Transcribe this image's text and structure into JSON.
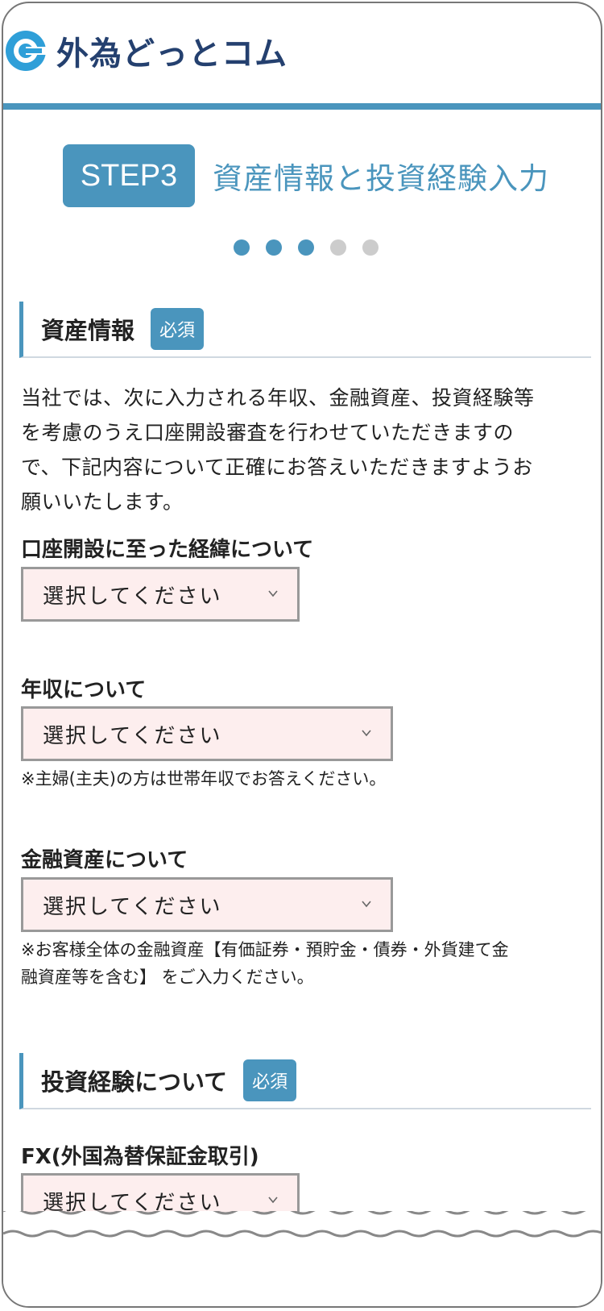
{
  "header": {
    "logo_text": "外為どっとコム"
  },
  "step": {
    "badge": "STEP3",
    "title": "資産情報と投資経験入力"
  },
  "progress": {
    "total": 5,
    "current": 3
  },
  "sections": {
    "asset": {
      "title": "資産情報",
      "required": "必須"
    },
    "invest": {
      "title": "投資経験について",
      "required": "必須"
    }
  },
  "intro_lines": [
    "当社では、次に入力される年収、金融資産、投資経験等",
    "を考慮のうえ口座開設審査を行わせていただきますの",
    "で、下記内容について正確にお答えいただきますようお",
    "願いいたします。"
  ],
  "fields": {
    "reason": {
      "label": "口座開設に至った経緯について",
      "value": "選択してください"
    },
    "income": {
      "label": "年収について",
      "value": "選択してください",
      "note": "※主婦(主夫)の方は世帯年収でお答えください。"
    },
    "assets": {
      "label": "金融資産について",
      "value": "選択してください",
      "note_lines": [
        "※お客様全体の金融資産【有価証券・預貯金・債券・外貨建て金",
        "融資産等を含む】 をご入力ください。"
      ]
    },
    "fx": {
      "label": "FX(外国為替保証金取引)",
      "value": "選択してください"
    }
  },
  "colors": {
    "accent": "#4a95bd",
    "navy": "#24406f",
    "select_bg": "#fdeeee"
  }
}
